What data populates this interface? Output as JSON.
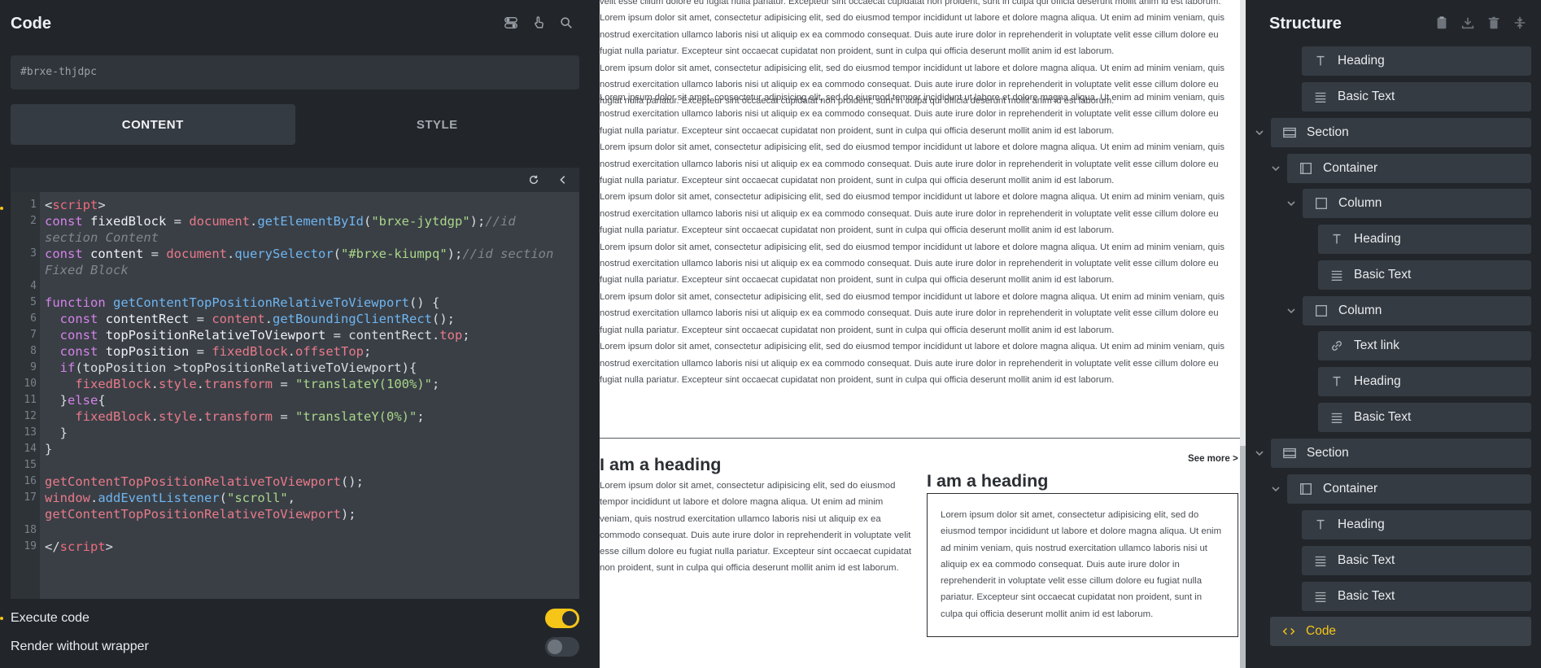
{
  "left_panel": {
    "title": "Code",
    "css_id": "#brxe-thjdpc",
    "tabs": [
      {
        "label": "CONTENT",
        "active": true
      },
      {
        "label": "STYLE",
        "active": false
      }
    ],
    "code_lines": [
      "1",
      "2",
      "",
      "3",
      "",
      "4",
      "5",
      "6",
      "7",
      "8",
      "9",
      "10",
      "11",
      "12",
      "13",
      "14",
      "15",
      "16",
      "17",
      "",
      "18",
      "19"
    ],
    "toggles": {
      "execute_code": {
        "label": "Execute code",
        "on": true
      },
      "render_without_wrapper": {
        "label": "Render without wrapper",
        "on": false
      }
    }
  },
  "canvas": {
    "lorem": "Lorem ipsum dolor sit amet, consectetur adipisicing elit, sed do eiusmod tempor incididunt ut labore et dolore magna aliqua. Ut enim ad minim veniam, quis nostrud exercitation ullamco laboris nisi ut aliquip ex ea commodo consequat. Duis aute irure dolor in reprehenderit in voluptate velit esse cillum dolore eu fugiat nulla pariatur. Excepteur sint occaecat cupidatat non proident, sunt in culpa qui officia deserunt mollit anim id est laborum.",
    "lorem_tail": "velit esse cillum dolore eu fugiat nulla pariatur. Excepteur sint occaecat cupidatat non proident, sunt in culpa qui officia deserunt mollit anim id est laborum.",
    "heading_1": "I am a heading",
    "heading_2": "I am a heading",
    "see_more": "See more >",
    "col_text_1": "Lorem ipsum dolor sit amet, consectetur adipisicing elit, sed do eiusmod tempor incididunt ut labore et dolore magna aliqua. Ut enim ad minim veniam, quis nostrud exercitation ullamco laboris nisi ut aliquip ex ea commodo consequat. Duis aute irure dolor in reprehenderit in voluptate velit esse cillum dolore eu fugiat nulla pariatur. Excepteur sint occaecat cupidatat non proident, sunt in culpa qui officia deserunt mollit anim id est laborum.",
    "box_text": "Lorem ipsum dolor sit amet, consectetur adipisicing elit, sed do eiusmod tempor incididunt ut labore et dolore magna aliqua. Ut enim ad minim veniam, quis nostrud exercitation ullamco laboris nisi ut aliquip ex ea commodo consequat. Duis aute irure dolor in reprehenderit in voluptate velit esse cillum dolore eu fugiat nulla pariatur. Excepteur sint occaecat cupidatat non proident, sunt in culpa qui officia deserunt mollit anim id est laborum."
  },
  "structure": {
    "title": "Structure",
    "nodes": [
      {
        "label": "Heading",
        "icon": "heading-icon"
      },
      {
        "label": "Basic Text",
        "icon": "text-lines-icon"
      },
      {
        "label": "Section",
        "icon": "section-icon"
      },
      {
        "label": "Container",
        "icon": "container-icon"
      },
      {
        "label": "Column",
        "icon": "column-icon"
      },
      {
        "label": "Heading",
        "icon": "heading-icon"
      },
      {
        "label": "Basic Text",
        "icon": "text-lines-icon"
      },
      {
        "label": "Column",
        "icon": "column-icon"
      },
      {
        "label": "Text link",
        "icon": "link-icon"
      },
      {
        "label": "Heading",
        "icon": "heading-icon"
      },
      {
        "label": "Basic Text",
        "icon": "text-lines-icon"
      },
      {
        "label": "Section",
        "icon": "section-icon"
      },
      {
        "label": "Container",
        "icon": "container-icon"
      },
      {
        "label": "Heading",
        "icon": "heading-icon"
      },
      {
        "label": "Basic Text",
        "icon": "text-lines-icon"
      },
      {
        "label": "Basic Text",
        "icon": "text-lines-icon"
      },
      {
        "label": "Code",
        "icon": "code-icon",
        "active": true
      }
    ]
  },
  "colors": {
    "accent": "#f5c518",
    "panel_bg": "#22262b",
    "node_bg": "#353b42"
  }
}
